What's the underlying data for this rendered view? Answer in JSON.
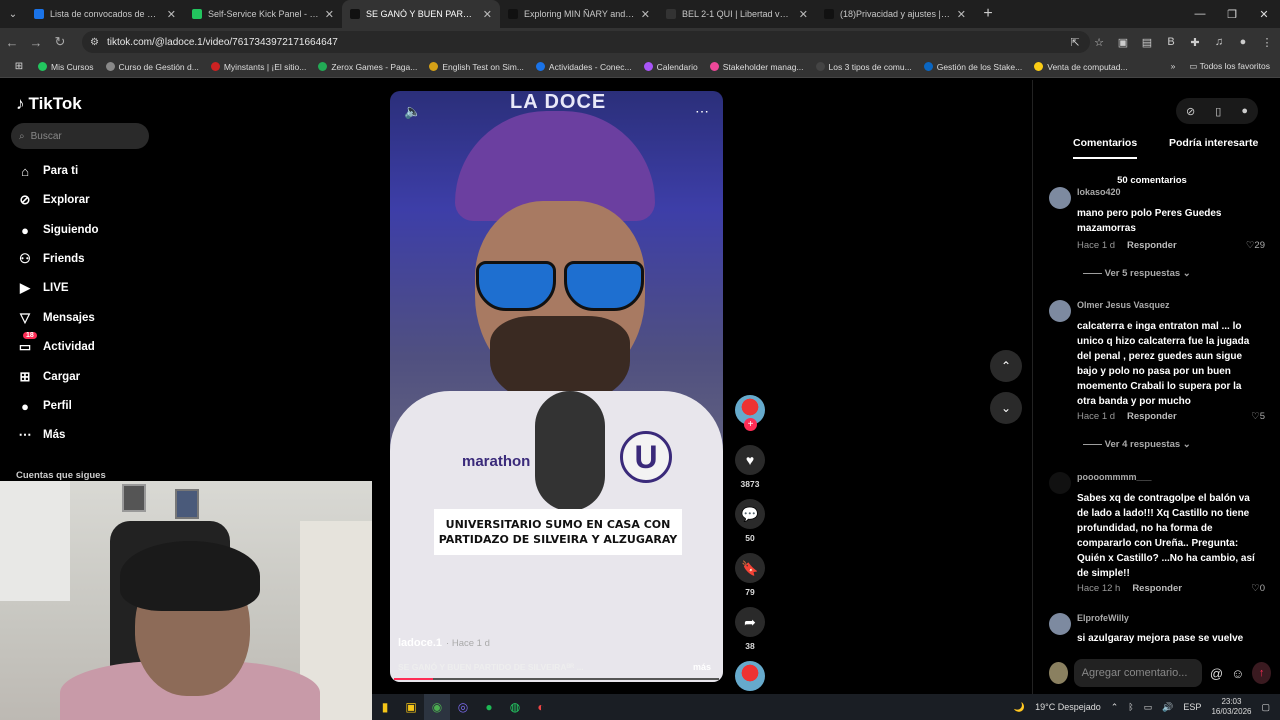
{
  "browser": {
    "tabs": [
      {
        "title": "Lista de convocados de Perú pa",
        "color": "#1a73e8"
      },
      {
        "title": "Self-Service Kick Panel - OwnK",
        "color": "#22c55e"
      },
      {
        "title": "SE GANÓ Y BUEN PARTIDO DE",
        "color": "#111111"
      },
      {
        "title": "Exploring MIN ÑARY and Its Cu",
        "color": "#111111"
      },
      {
        "title": "BEL 2-1 QUI | Libertad vs LDU C",
        "color": "#333333"
      },
      {
        "title": "(18)Privacidad y ajustes | TikTok",
        "color": "#111111"
      }
    ],
    "active_tab": 2,
    "url": "tiktok.com/@ladoce.1/video/7617343972171664647",
    "bookmarks": [
      {
        "label": "Mis Cursos",
        "color": "#22c55e"
      },
      {
        "label": "Curso de Gestión d...",
        "color": "#888888"
      },
      {
        "label": "Myinstants | ¡El sitio...",
        "color": "#cc2222"
      },
      {
        "label": "Zerox Games - Paga...",
        "color": "#22aa55"
      },
      {
        "label": "English Test on Sim...",
        "color": "#d4a017"
      },
      {
        "label": "Actividades - Conec...",
        "color": "#1a73e8"
      },
      {
        "label": "Calendario",
        "color": "#a855f7"
      },
      {
        "label": "Stakeholder manag...",
        "color": "#ec4899"
      },
      {
        "label": "Los 3 tipos de comu...",
        "color": "#444444"
      },
      {
        "label": "Gestión de los Stake...",
        "color": "#0a66c2"
      },
      {
        "label": "Venta de computad...",
        "color": "#facc15"
      }
    ],
    "all_favorites": "Todos los favoritos"
  },
  "sidebar": {
    "logo": "TikTok",
    "search_placeholder": "Buscar",
    "items": [
      {
        "label": "Para ti",
        "icon": "home-icon"
      },
      {
        "label": "Explorar",
        "icon": "compass-icon"
      },
      {
        "label": "Siguiendo",
        "icon": "following-avatar-icon"
      },
      {
        "label": "Friends",
        "icon": "friends-icon"
      },
      {
        "label": "LIVE",
        "icon": "live-icon"
      },
      {
        "label": "Mensajes",
        "icon": "messages-icon"
      },
      {
        "label": "Actividad",
        "icon": "activity-icon",
        "badge": "18"
      },
      {
        "label": "Cargar",
        "icon": "upload-icon"
      },
      {
        "label": "Perfil",
        "icon": "profile-icon"
      },
      {
        "label": "Más",
        "icon": "more-icon"
      }
    ],
    "following_header": "Cuentas que sigues"
  },
  "video": {
    "caption_overlay": "UNIVERSITARIO SUMO EN CASA CON PARTIDAZO DE SILVEIRA Y ALZUGARAY",
    "author": "ladoce.1",
    "posted": "· Hace 1 d",
    "description": "SE GANÓ Y BUEN PARTIDO DE SILVEIRAᴮᴿ ...",
    "more": "más",
    "sign_text": "LA DOCE",
    "shirt_brand": "marathon",
    "progress": 0.12
  },
  "actions": {
    "likes": "3873",
    "comments": "50",
    "saves": "79",
    "shares": "38"
  },
  "comments_panel": {
    "tab_comments": "Comentarios",
    "tab_related": "Podría interesarte",
    "count": "50 comentarios",
    "reply_label": "Responder",
    "comments": [
      {
        "user": "lokaso420",
        "text": "mano pero polo Peres Guedes mazamorras",
        "time": "Hace 1 d",
        "likes": "29",
        "replies": "Ver 5 respuestas"
      },
      {
        "user": "Olmer Jesus Vasquez",
        "text": "calcaterra e inga entraton mal ... lo unico q hizo calcaterra fue la jugada del penal , perez guedes aun sigue bajo y polo no pasa por un buen moemento Crabali lo supera por la otra banda y por mucho",
        "time": "Hace 1 d",
        "likes": "5",
        "replies": "Ver 4 respuestas"
      },
      {
        "user": "poooommmm___",
        "text": "Sabes xq de contragolpe el balón va de lado a lado!!! Xq Castillo no tiene profundidad, no ha forma de compararlo con Ureña.. Pregunta: Quién x Castillo? ...No ha cambio, así de simple!!",
        "time": "Hace 12 h",
        "likes": "0"
      },
      {
        "user": "ElprofeWilly",
        "text": "si azulgaray mejora pase se vuelve"
      }
    ],
    "add_placeholder": "Agregar comentario..."
  },
  "taskbar": {
    "weather": "19°C  Despejado",
    "lang": "ESP",
    "time": "23:03",
    "date": "16/03/2026"
  }
}
